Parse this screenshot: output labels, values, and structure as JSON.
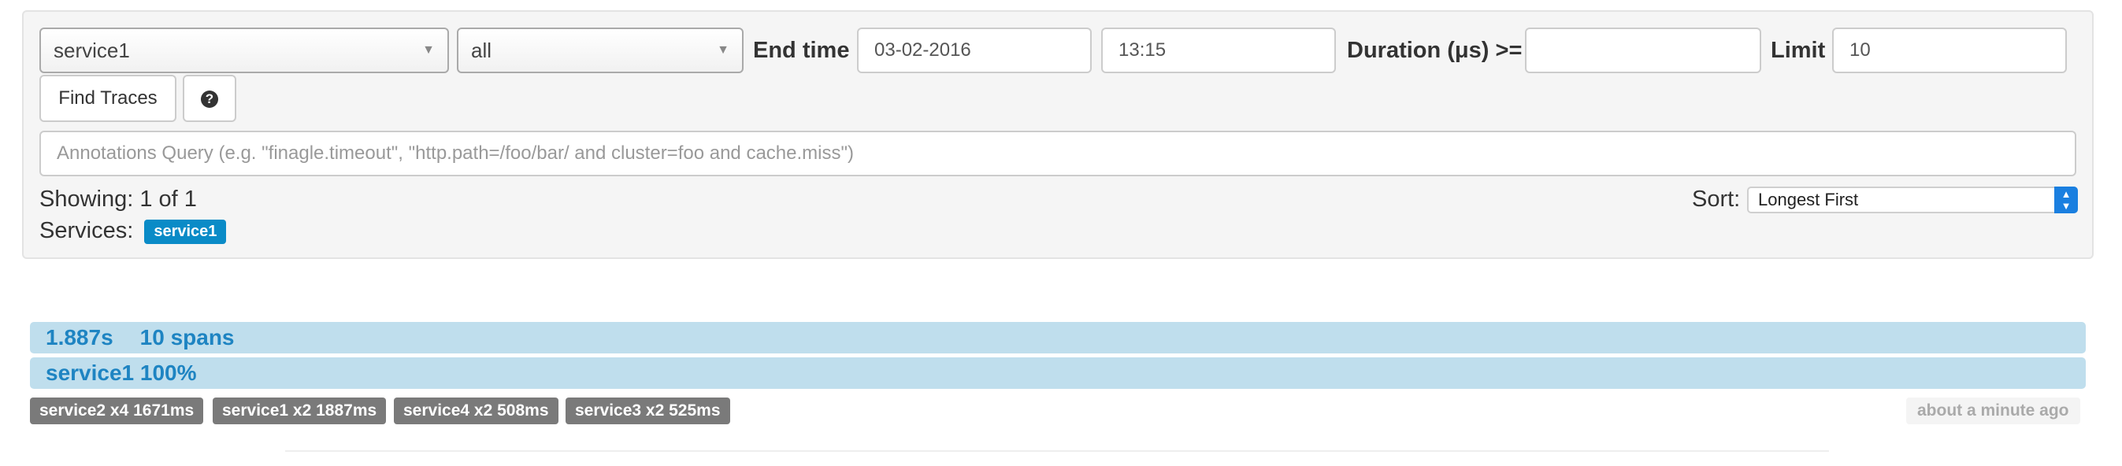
{
  "search": {
    "service_select": "service1",
    "span_select": "all",
    "end_time_label": "End time",
    "end_date": "03-02-2016",
    "end_time": "13:15",
    "duration_label": "Duration (μs) >=",
    "duration_value": "",
    "limit_label": "Limit",
    "limit_value": "10",
    "find_traces_label": "Find Traces",
    "help_icon": "?",
    "annotations_placeholder": "Annotations Query (e.g. \"finagle.timeout\", \"http.path=/foo/bar/ and cluster=foo and cache.miss\")",
    "annotations_value": ""
  },
  "results": {
    "showing": "Showing: 1 of 1",
    "services_label": "Services:",
    "service_tags": [
      "service1"
    ],
    "sort_label": "Sort:",
    "sort_value": "Longest First"
  },
  "trace": {
    "duration": "1.887s",
    "spans": "10 spans",
    "service_bar": "service1 100%",
    "service_labels": [
      "service2 x4 1671ms",
      "service1 x2 1887ms",
      "service4 x2 508ms",
      "service3 x2 525ms"
    ],
    "timestamp": "about a minute ago"
  },
  "colors": {
    "accent": "#0a8bc7",
    "trace_bar_bg": "#bfdeed",
    "trace_bar_text": "#1e84c2",
    "service_label_bg": "#7a7a7a",
    "sort_arrow": "#1a7fe0"
  },
  "icons": {
    "help": "question-circle-icon",
    "select_caret": "caret-down-icon",
    "sort_arrows": "up-down-arrows-icon"
  }
}
